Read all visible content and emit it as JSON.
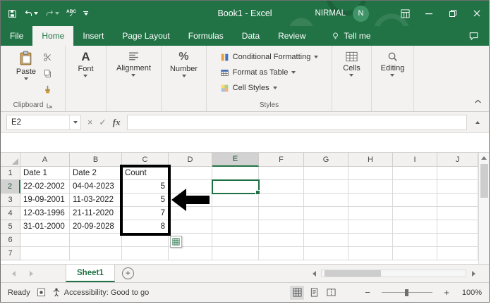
{
  "window": {
    "title": "Book1 - Excel",
    "user_name": "NIRMAL",
    "avatar_initial": "N"
  },
  "menu": {
    "tabs": [
      "File",
      "Home",
      "Insert",
      "Page Layout",
      "Formulas",
      "Data",
      "Review"
    ],
    "active_tab": "Home",
    "tell_me": "Tell me"
  },
  "ribbon": {
    "paste": "Paste",
    "clipboard_group": "Clipboard",
    "font_group": "Font",
    "font_glyph": "A",
    "alignment_group": "Alignment",
    "number_group": "Number",
    "number_glyph": "%",
    "conditional_formatting": "Conditional Formatting",
    "format_as_table": "Format as Table",
    "cell_styles": "Cell Styles",
    "styles_group": "Styles",
    "cells_group": "Cells",
    "editing_group": "Editing"
  },
  "formula_bar": {
    "name_box": "E2",
    "cancel_glyph": "×",
    "enter_glyph": "✓",
    "fx_label": "fx",
    "formula_value": ""
  },
  "grid": {
    "col_headers": [
      "A",
      "B",
      "C",
      "D",
      "E",
      "F",
      "G",
      "H",
      "I",
      "J"
    ],
    "row_headers": [
      "1",
      "2",
      "3",
      "4",
      "5",
      "6",
      "7"
    ],
    "selected_col": "E",
    "selected_row": "2",
    "active_cell": "E2",
    "rows": [
      [
        "Date 1",
        "Date 2",
        "Count",
        "",
        "",
        "",
        "",
        "",
        "",
        ""
      ],
      [
        "22-02-2002",
        "04-04-2023",
        "5",
        "",
        "",
        "",
        "",
        "",
        "",
        ""
      ],
      [
        "19-09-2001",
        "11-03-2022",
        "5",
        "",
        "",
        "",
        "",
        "",
        "",
        ""
      ],
      [
        "12-03-1996",
        "21-11-2020",
        "7",
        "",
        "",
        "",
        "",
        "",
        "",
        ""
      ],
      [
        "31-01-2000",
        "20-09-2028",
        "8",
        "",
        "",
        "",
        "",
        "",
        "",
        ""
      ],
      [
        "",
        "",
        "",
        "",
        "",
        "",
        "",
        "",
        "",
        ""
      ],
      [
        "",
        "",
        "",
        "",
        "",
        "",
        "",
        "",
        "",
        ""
      ]
    ]
  },
  "sheet_bar": {
    "active_tab": "Sheet1",
    "add_glyph": "+"
  },
  "status_bar": {
    "mode": "Ready",
    "accessibility": "Accessibility: Good to go",
    "zoom_out_glyph": "−",
    "zoom_in_glyph": "+",
    "zoom_level": "100%"
  },
  "colors": {
    "excel_green": "#217346",
    "selection_green": "#1e7145",
    "annotation": "#000000"
  }
}
